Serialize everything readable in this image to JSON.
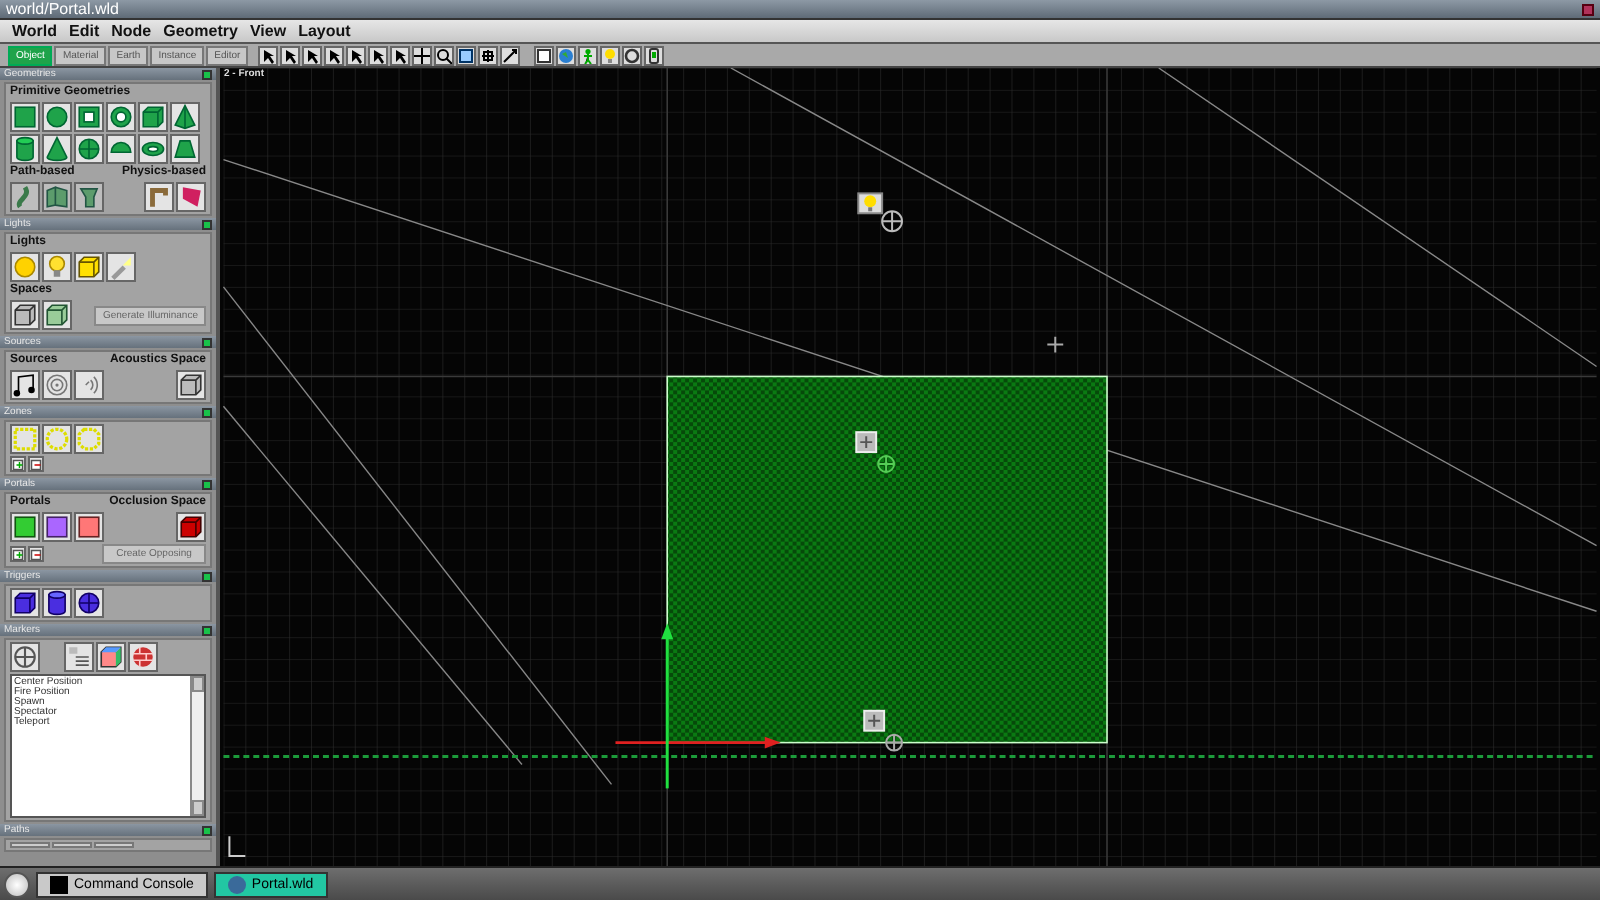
{
  "window": {
    "title": "world/Portal.wld"
  },
  "menu": [
    "World",
    "Edit",
    "Node",
    "Geometry",
    "View",
    "Layout"
  ],
  "mode_tabs": [
    {
      "label": "Object",
      "selected": true
    },
    {
      "label": "Material",
      "selected": false
    },
    {
      "label": "Earth",
      "selected": false
    },
    {
      "label": "Instance",
      "selected": false
    },
    {
      "label": "Editor",
      "selected": false
    }
  ],
  "panel": [
    {
      "kind": "geometries",
      "title": "Geometries",
      "expanded": true,
      "labels": [
        "Primitive Geometries",
        "Path-based",
        "Physics-based"
      ]
    },
    {
      "kind": "lights",
      "title": "Lights",
      "expanded": true,
      "labels": [
        "Lights",
        "Spaces"
      ],
      "button": "Generate Illuminance"
    },
    {
      "kind": "sources",
      "title": "Sources",
      "expanded": true,
      "labels": [
        "Sources",
        "Acoustics Space"
      ]
    },
    {
      "kind": "zones",
      "title": "Zones",
      "expanded": true
    },
    {
      "kind": "portals",
      "title": "Portals",
      "expanded": true,
      "labels": [
        "Portals",
        "Occlusion Space"
      ],
      "button": "Create Opposing"
    },
    {
      "kind": "triggers",
      "title": "Triggers",
      "expanded": true
    },
    {
      "kind": "markers",
      "title": "Markers",
      "expanded": true,
      "items": [
        "Center Position",
        "Fire Position",
        "Spawn",
        "Spectator",
        "Teleport"
      ]
    },
    {
      "kind": "paths",
      "title": "Paths",
      "expanded": true
    }
  ],
  "viewport": {
    "title": "2 - Front"
  },
  "taskbar": [
    {
      "label": "Command Console",
      "selected": false
    },
    {
      "label": "Portal.wld",
      "selected": true
    }
  ]
}
